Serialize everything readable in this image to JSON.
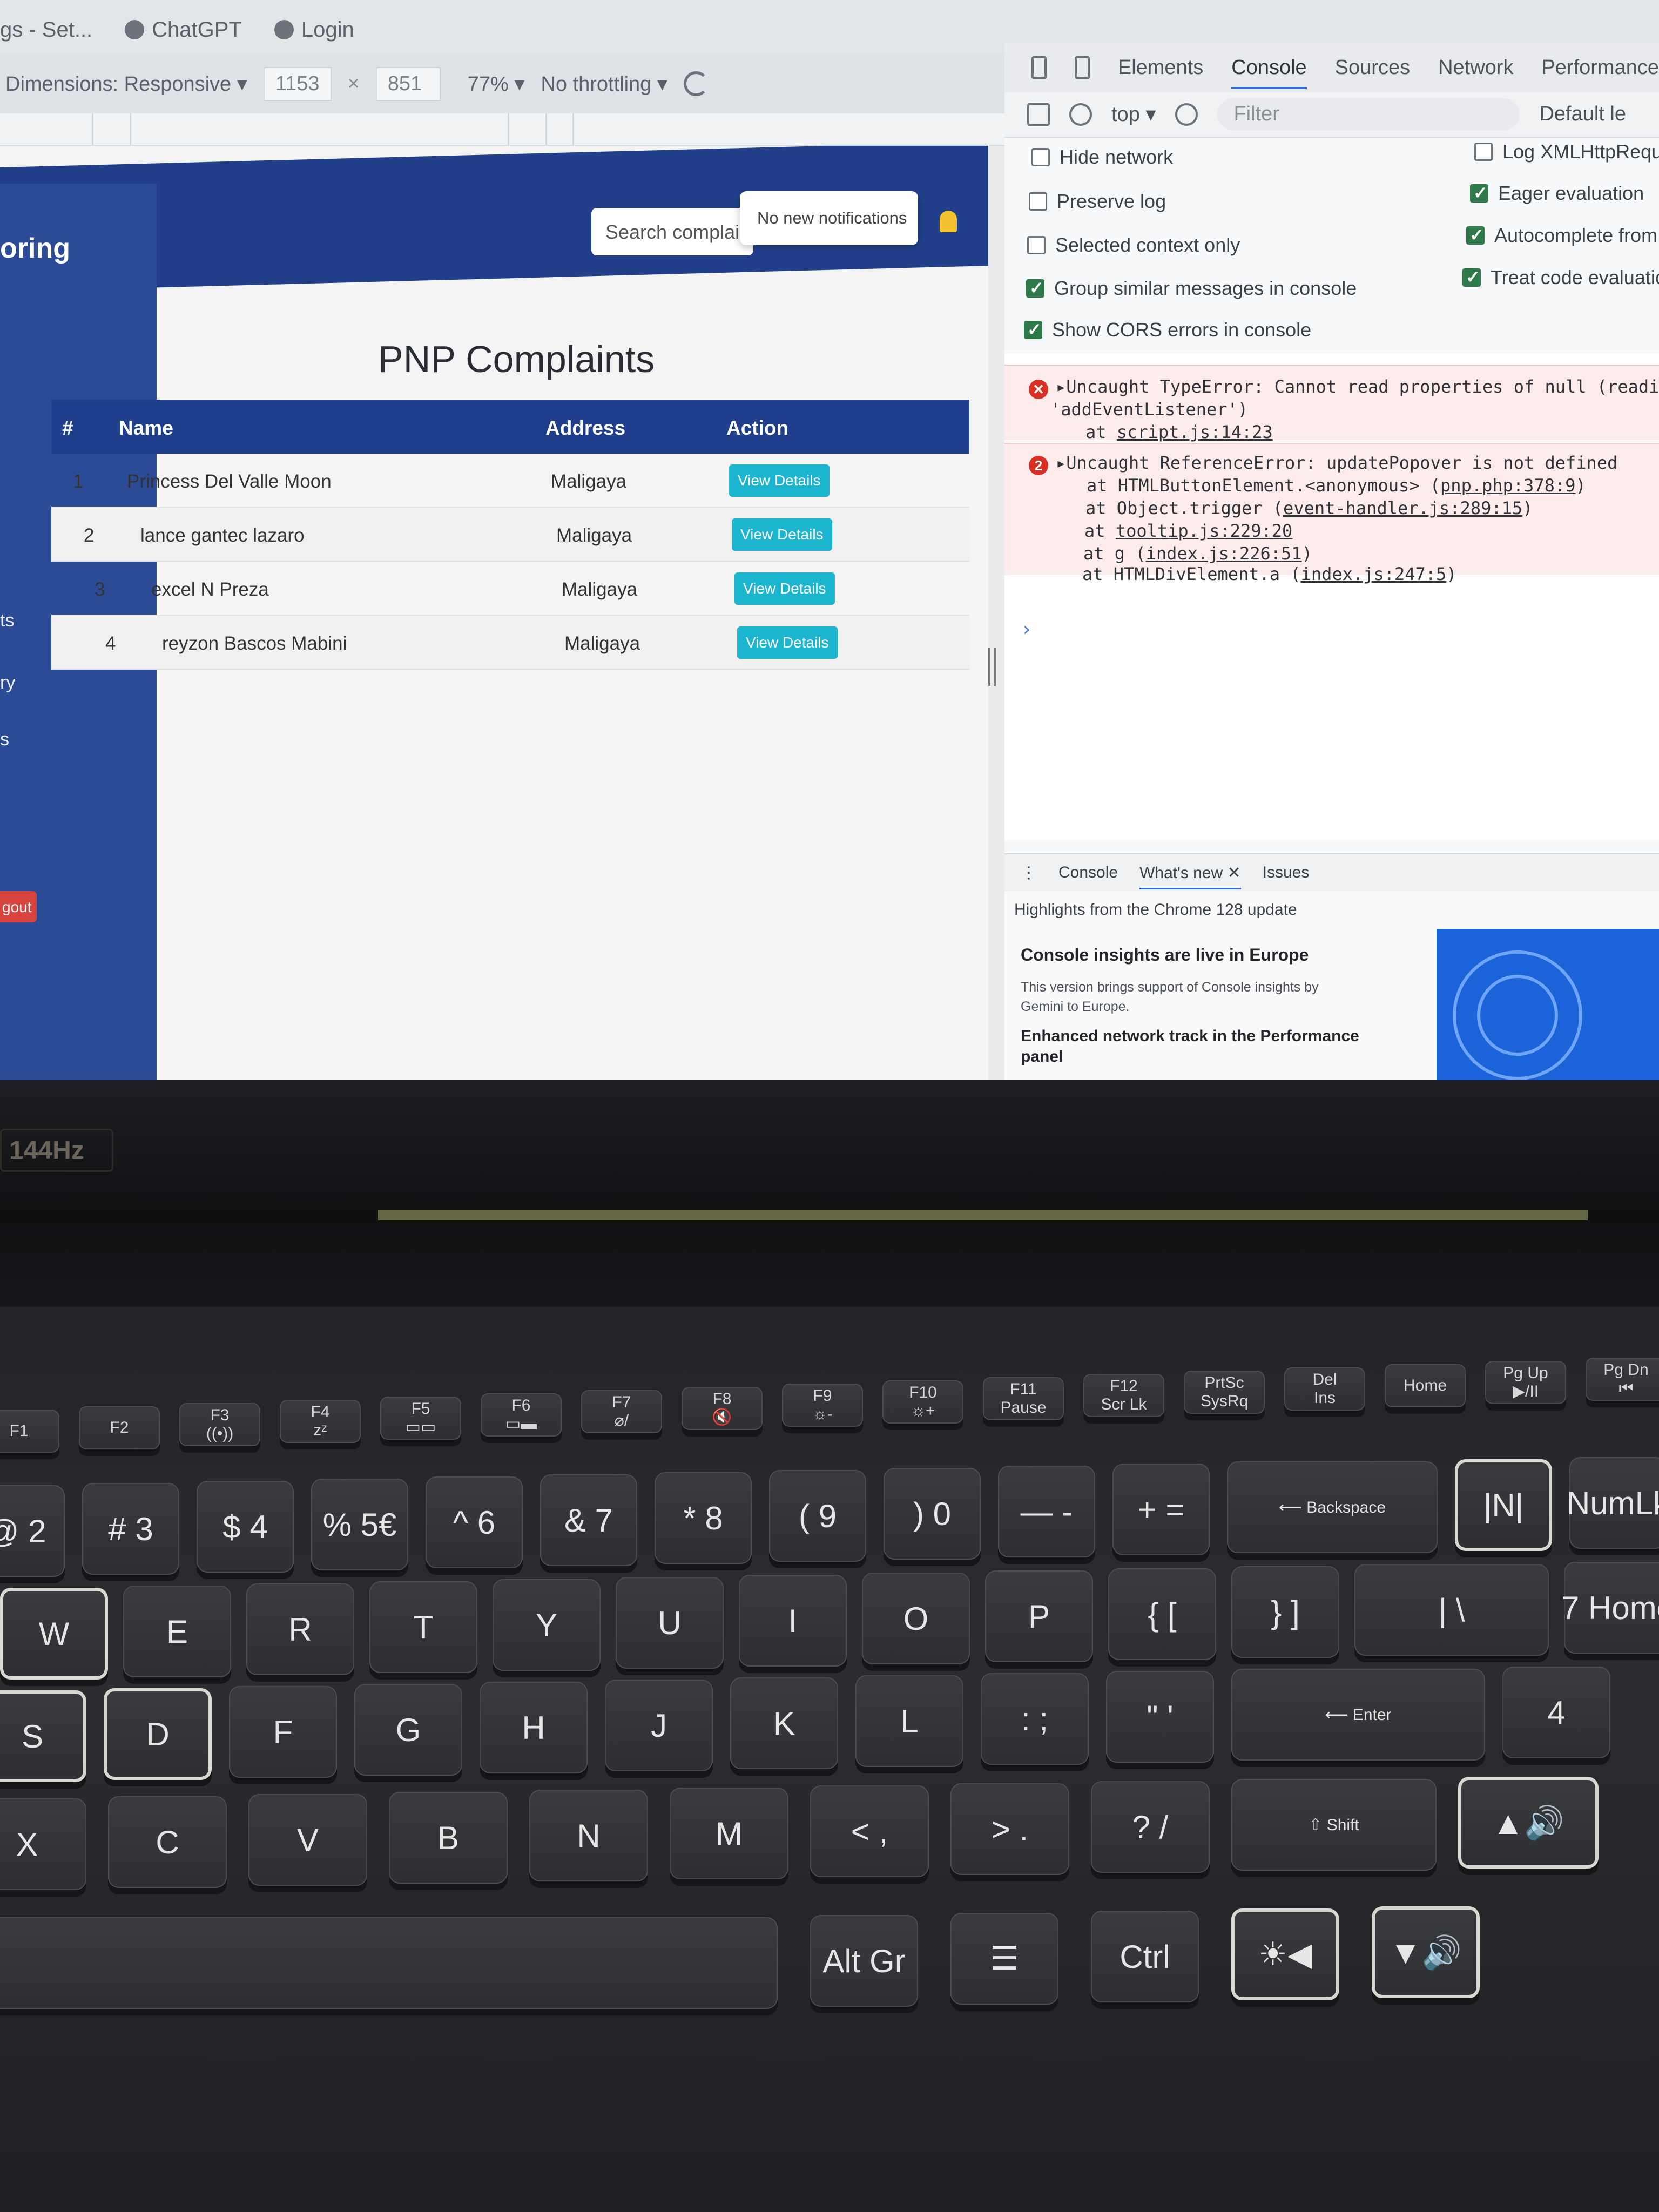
{
  "bookmarks": [
    "gs - Set...",
    "ChatGPT",
    "Login"
  ],
  "device_toolbar": {
    "dimensions_label": "Dimensions: Responsive ▾",
    "width": "1153",
    "times": "×",
    "height": "851",
    "zoom": "77% ▾",
    "throttling": "No throttling ▾"
  },
  "app": {
    "brand": "oring",
    "search_placeholder": "Search complaint",
    "notification": "No new notifications",
    "sidebar_fragments": [
      "ts",
      "ry",
      "s"
    ],
    "logout_label": "gout",
    "page_title": "PNP Complaints",
    "table": {
      "headers": [
        "#",
        "Name",
        "Address",
        "Action"
      ],
      "rows": [
        {
          "num": "1",
          "name": "Princess Del Valle Moon",
          "address": "Maligaya",
          "action": "View Details"
        },
        {
          "num": "2",
          "name": "lance gantec lazaro",
          "address": "Maligaya",
          "action": "View Details"
        },
        {
          "num": "3",
          "name": "excel N Preza",
          "address": "Maligaya",
          "action": "View Details"
        },
        {
          "num": "4",
          "name": "reyzon Bascos Mabini",
          "address": "Maligaya",
          "action": "View Details"
        }
      ]
    }
  },
  "devtools": {
    "tabs": [
      "Elements",
      "Console",
      "Sources",
      "Network",
      "Performance"
    ],
    "active_tab": "Console",
    "context": "top ▾",
    "filter_placeholder": "Filter",
    "default_levels": "Default le",
    "settings_left": [
      {
        "label": "Hide network",
        "checked": false
      },
      {
        "label": "Preserve log",
        "checked": false
      },
      {
        "label": "Selected context only",
        "checked": false
      },
      {
        "label": "Group similar messages in console",
        "checked": true
      },
      {
        "label": "Show CORS errors in console",
        "checked": true
      }
    ],
    "settings_right": [
      {
        "label": "Log XMLHttpReques",
        "checked": false
      },
      {
        "label": "Eager evaluation",
        "checked": true
      },
      {
        "label": "Autocomplete from hi",
        "checked": true
      },
      {
        "label": "Treat code evaluation a",
        "checked": true
      }
    ],
    "errors": [
      {
        "badge": "✕",
        "message": "▸Uncaught TypeError: Cannot read properties of null (reading",
        "message2": "'addEventListener')",
        "stack": [
          {
            "text": "at ",
            "link": "script.js:14:23"
          }
        ]
      },
      {
        "badge": "2",
        "message": "▸Uncaught ReferenceError: updatePopover is not defined",
        "stack": [
          {
            "text": "at HTMLButtonElement.<anonymous> (",
            "link": "pnp.php:378:9",
            "tail": ")"
          },
          {
            "text": "at Object.trigger (",
            "link": "event-handler.js:289:15",
            "tail": ")"
          },
          {
            "text": "at ",
            "link": "tooltip.js:229:20"
          },
          {
            "text": "at g (",
            "link": "index.js:226:51",
            "tail": ")"
          },
          {
            "text": "at HTMLDivElement.a (",
            "link": "index.js:247:5",
            "tail": ")"
          }
        ]
      }
    ],
    "prompt": "›",
    "drawer_tabs": [
      "Console",
      "What's new ✕",
      "Issues"
    ],
    "drawer_active": "What's new ✕",
    "whats_new": {
      "header": "Highlights from the Chrome 128 update",
      "title1": "Console insights are live in Europe",
      "body": "This version brings support of Console insights by Gemini to Europe.",
      "title2": "Enhanced network track in the Performance panel"
    }
  },
  "laptop": {
    "refresh_badge": "144Hz"
  },
  "keyboard": {
    "function_row": [
      [
        "F1",
        ""
      ],
      [
        "F2",
        ""
      ],
      [
        "F3",
        "((•))"
      ],
      [
        "F4",
        "zᶻ"
      ],
      [
        "F5",
        "▭▭"
      ],
      [
        "F6",
        "▭▬"
      ],
      [
        "F7",
        "⌀/"
      ],
      [
        "F8",
        "🔇"
      ],
      [
        "F9",
        "☼-"
      ],
      [
        "F10",
        "☼+"
      ],
      [
        "F11",
        "Pause"
      ],
      [
        "F12",
        "Scr Lk"
      ],
      [
        "PrtSc",
        "SysRq"
      ],
      [
        "Del",
        "Ins"
      ],
      [
        "Home",
        ""
      ],
      [
        "Pg Up",
        "▶/II"
      ],
      [
        "Pg Dn",
        "⏮"
      ]
    ],
    "number_row": [
      "@ 2",
      "# 3",
      "$ 4",
      "% 5€",
      "^ 6",
      "& 7",
      "* 8",
      "( 9",
      ") 0",
      "— -",
      "+ =",
      "⟵ Backspace",
      "|N|",
      "NumLk"
    ],
    "letter_row1": [
      "W",
      "E",
      "R",
      "T",
      "Y",
      "U",
      "I",
      "O",
      "P",
      "{ [",
      "} ]",
      "| \\",
      "7 Home"
    ],
    "letter_row2": [
      "S",
      "D",
      "F",
      "G",
      "H",
      "J",
      "K",
      "L",
      ": ;",
      "\" '",
      "⟵ Enter",
      "4"
    ],
    "letter_row3": [
      "X",
      "C",
      "V",
      "B",
      "N",
      "M",
      "< ,",
      "> .",
      "? /",
      "⇧ Shift",
      "▲🔊"
    ],
    "bottom_row": [
      "",
      "Alt Gr",
      "☰",
      "Ctrl",
      "☀◀",
      "▼🔊"
    ]
  }
}
